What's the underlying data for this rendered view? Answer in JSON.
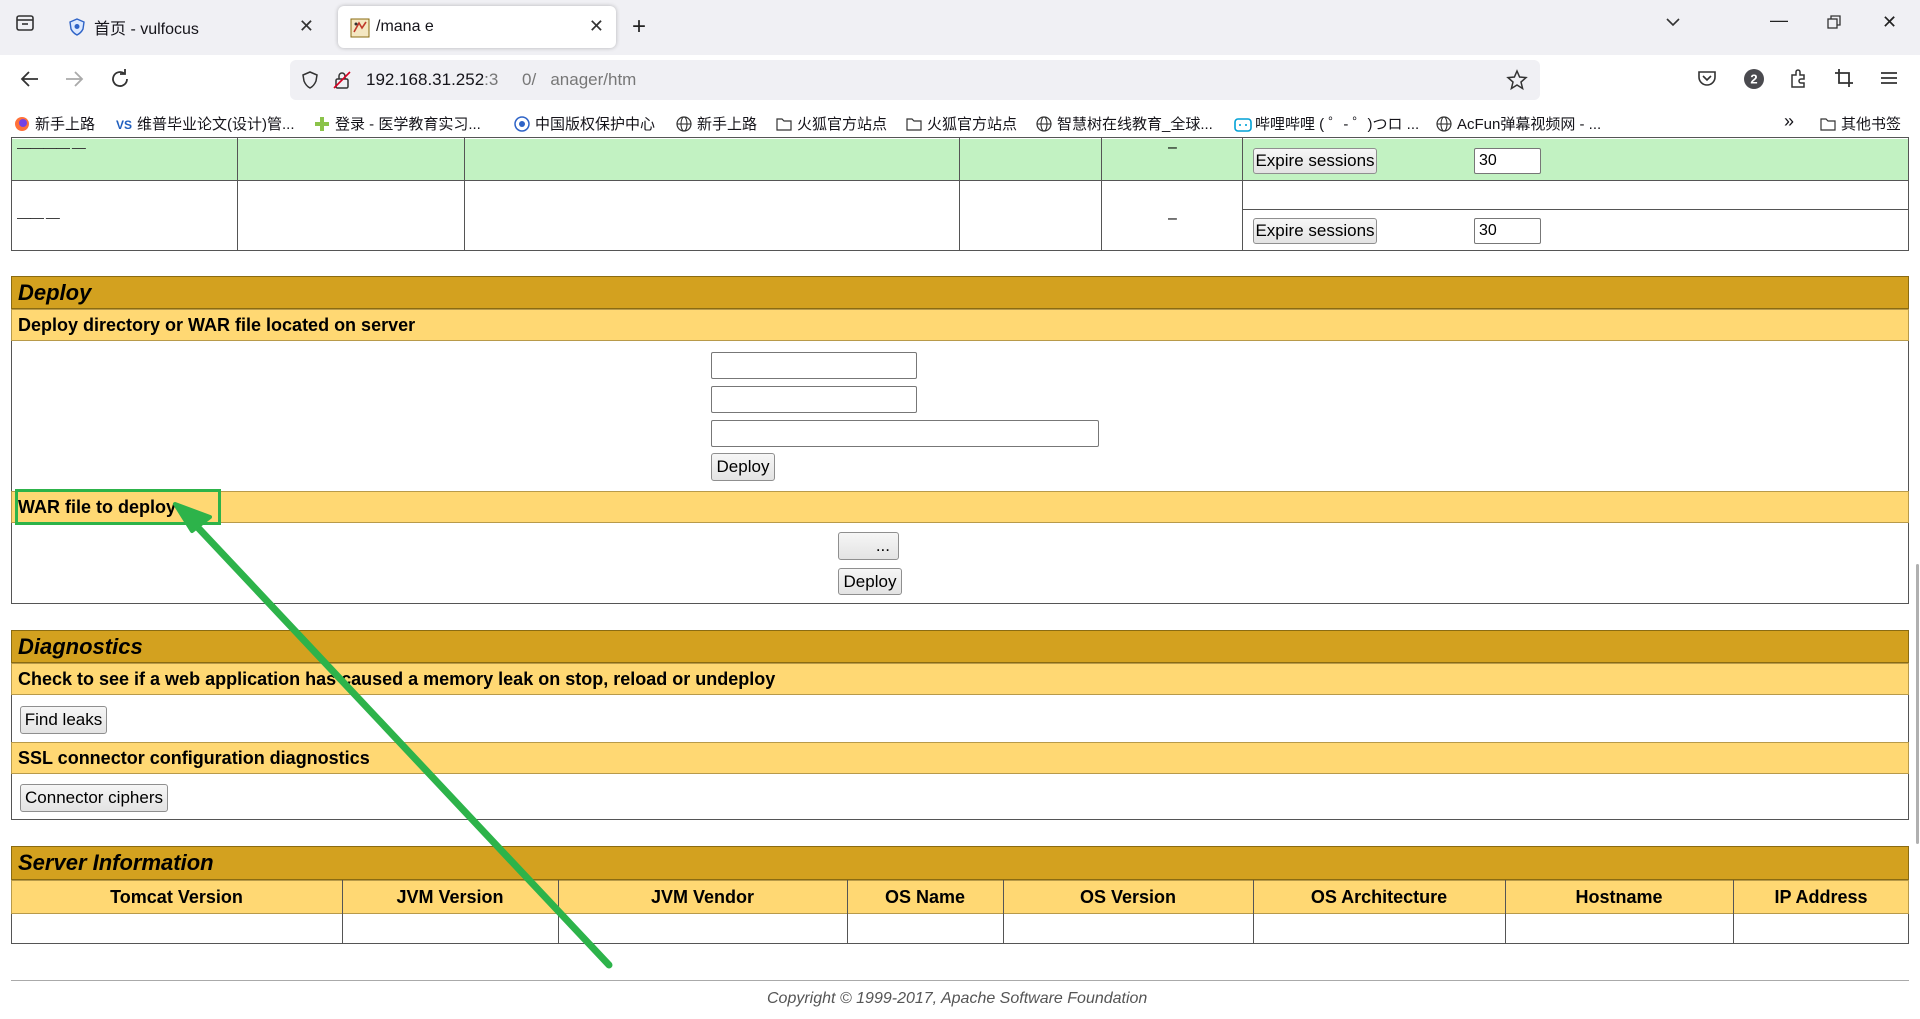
{
  "browser": {
    "tabs": [
      {
        "title": "首页 - vulfocus",
        "active": false
      },
      {
        "title": "/mana  e",
        "active": true
      }
    ],
    "url": {
      "host": "192.168.31.252",
      "port_fragment": ":3",
      "gap": "     ",
      "rest_fragment": "0/   anager/htm"
    },
    "profile_badge": "2",
    "bookmarks": [
      "新手上路",
      "维普毕业论文(设计)管...",
      "登录 - 医学教育实习...",
      "中国版权保护中心",
      "新手上路",
      "火狐官方站点",
      "火狐官方站点",
      "智慧树在线教育_全球...",
      "哔哩哔哩 ( ゜- ゜)つロ ...",
      "AcFun弹幕视频网 - ...",
      "其他书签"
    ]
  },
  "sessions": {
    "row1": {
      "dash": "–",
      "expire_label": "Expire sessions",
      "idle_value": "30",
      "left_text": "———— —"
    },
    "row2": {
      "dash": "–",
      "expire_label": "Expire sessions",
      "idle_value": "30",
      "left_text": "——  —"
    }
  },
  "deploy": {
    "title": "Deploy",
    "server_subtitle": "Deploy directory or WAR file located on server",
    "server_deploy_button": "Deploy",
    "war_subtitle": "WAR file to deploy",
    "browse_button": "...",
    "war_deploy_button": "Deploy"
  },
  "diagnostics": {
    "title": "Diagnostics",
    "leak_subtitle": "Check to see if a web application has caused a memory leak on stop, reload or undeploy",
    "find_leaks_button": "Find leaks",
    "ssl_subtitle": "SSL connector configuration diagnostics",
    "ciphers_button": "Connector ciphers"
  },
  "server_info": {
    "title": "Server Information",
    "columns": [
      "Tomcat Version",
      "JVM Version",
      "JVM Vendor",
      "OS Name",
      "OS Version",
      "OS Architecture",
      "Hostname",
      "IP Address"
    ]
  },
  "footer": {
    "copyright": "Copyright © 1999-2017, Apache Software Foundation"
  },
  "annotation": {
    "highlight_color": "#2db34a",
    "arrow_color": "#2db34a"
  }
}
